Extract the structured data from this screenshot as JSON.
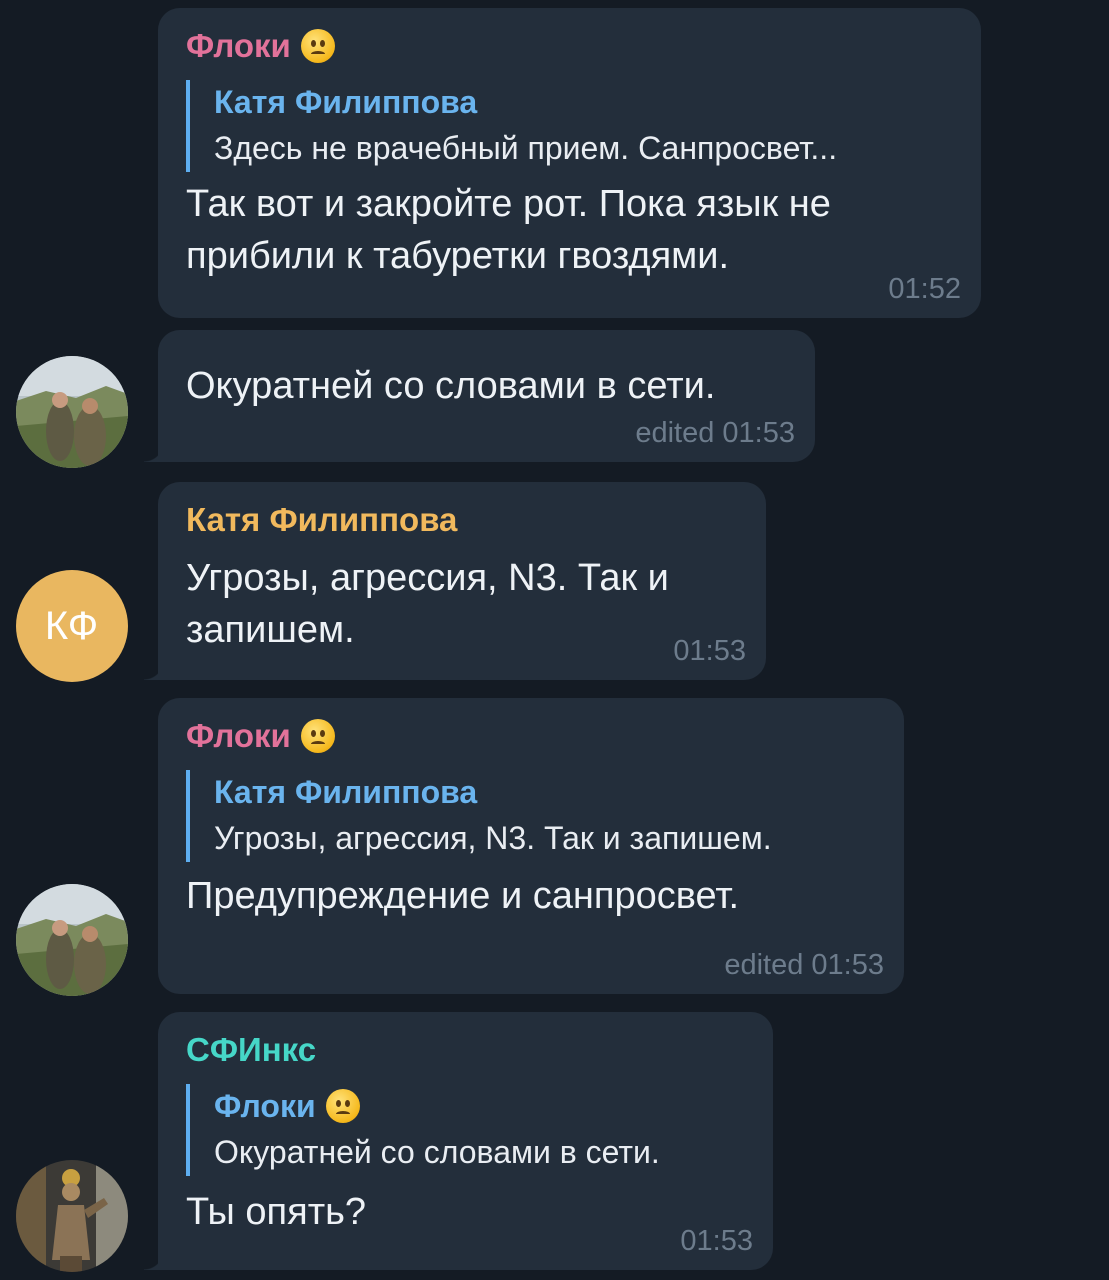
{
  "colors": {
    "background": "#141b24",
    "bubble": "#232e3b",
    "name_floki": "#e2729a",
    "name_katya": "#f1b95d",
    "name_sfinks": "#46d7c8",
    "reply_name": "#6ab4ee",
    "reply_bar": "#5eaef0",
    "meta": "#6d7c8c",
    "avatar_kf": "#e9b760"
  },
  "messages": [
    {
      "sender": "Флоки",
      "sender_emoji": "confused-face-icon",
      "reply_to": {
        "name": "Катя Филиппова",
        "text": "Здесь не врачебный прием. Санпросвет..."
      },
      "text_lines": [
        "Так вот и закройте рот. Пока язык не",
        "прибили к табуретки гвоздями."
      ],
      "time": "01:52"
    },
    {
      "text_lines": [
        "Окуратней со словами в сети."
      ],
      "time": "edited 01:53",
      "avatar": "photo-avatar-landscape"
    },
    {
      "sender": "Катя Филиппова",
      "text_lines": [
        "Угрозы, агрессия, N3. Так и",
        "запишем."
      ],
      "time": "01:53",
      "avatar_initials": "КФ"
    },
    {
      "sender": "Флоки",
      "sender_emoji": "confused-face-icon",
      "reply_to": {
        "name": "Катя Филиппова",
        "text": "Угрозы, агрессия, N3. Так и запишем."
      },
      "text_lines": [
        "Предупреждение и санпросвет."
      ],
      "time": "edited 01:53",
      "avatar": "photo-avatar-landscape"
    },
    {
      "sender": "СФИнкс",
      "reply_to": {
        "name": "Флоки",
        "name_emoji": "confused-face-icon",
        "text": "Окуратней со словами в сети."
      },
      "text_lines": [
        "Ты опять?"
      ],
      "time": "01:53",
      "avatar": "photo-avatar-statue"
    }
  ]
}
